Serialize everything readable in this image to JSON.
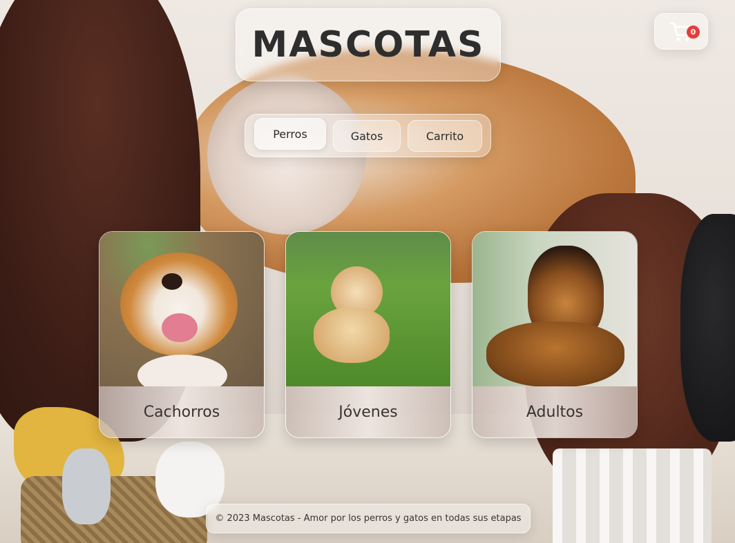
{
  "header": {
    "title": "MASCOTAS"
  },
  "cart": {
    "count": "0",
    "icon": "shopping-cart-icon"
  },
  "nav": {
    "items": [
      {
        "label": "Perros",
        "active": true
      },
      {
        "label": "Gatos"
      },
      {
        "label": "Carrito"
      }
    ]
  },
  "cards": [
    {
      "label": "Cachorros",
      "image": "beagle-puppy-photo"
    },
    {
      "label": "Jóvenes",
      "image": "golden-retriever-photo"
    },
    {
      "label": "Adultos",
      "image": "german-shepherd-photo"
    }
  ],
  "footer": {
    "text": "© 2023 Mascotas - Amor por los perros y gatos en todas sus etapas"
  },
  "colors": {
    "badge": "#e83b3b",
    "title": "#2e2e2e"
  }
}
